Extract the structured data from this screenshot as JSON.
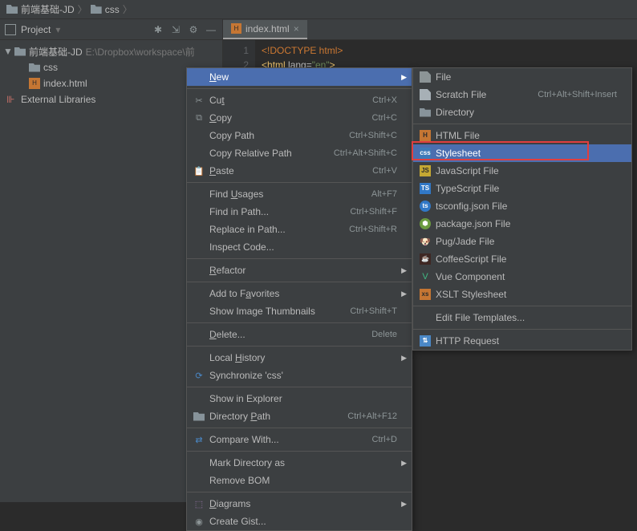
{
  "breadcrumb": {
    "root": "前端基础-JD",
    "sub": "css"
  },
  "toolwindow": {
    "title": "Project"
  },
  "tree": {
    "project_name": "前端基础-JD",
    "project_path": "E:\\Dropbox\\workspace\\前",
    "css_folder": "css",
    "index_file": "index.html",
    "ext_libs": "External Libraries"
  },
  "tab": {
    "name": "index.html"
  },
  "code": {
    "doctype": "<!DOCTYPE html>",
    "line2_open": "<",
    "line2_tag": "html",
    "line2_attr": " lang=",
    "line2_str": "\"en\"",
    "line2_close": ">"
  },
  "ctx": {
    "new": "New",
    "cut": "Cut",
    "cut_sc": "Ctrl+X",
    "copy": "Copy",
    "copy_sc": "Ctrl+C",
    "copy_path": "Copy Path",
    "copy_path_sc": "Ctrl+Shift+C",
    "copy_rel": "Copy Relative Path",
    "copy_rel_sc": "Ctrl+Alt+Shift+C",
    "paste": "Paste",
    "paste_sc": "Ctrl+V",
    "find_usages": "Find Usages",
    "find_usages_sc": "Alt+F7",
    "find_in_path": "Find in Path...",
    "find_in_path_sc": "Ctrl+Shift+F",
    "replace_in_path": "Replace in Path...",
    "replace_in_path_sc": "Ctrl+Shift+R",
    "inspect": "Inspect Code...",
    "refactor": "Refactor",
    "favorites": "Add to Favorites",
    "thumbnails": "Show Image Thumbnails",
    "thumbnails_sc": "Ctrl+Shift+T",
    "delete": "Delete...",
    "delete_sc": "Delete",
    "local_history": "Local History",
    "sync": "Synchronize 'css'",
    "explorer": "Show in Explorer",
    "dir_path": "Directory Path",
    "dir_path_sc": "Ctrl+Alt+F12",
    "compare": "Compare With...",
    "compare_sc": "Ctrl+D",
    "mark_dir": "Mark Directory as",
    "remove_bom": "Remove BOM",
    "diagrams": "Diagrams",
    "gist": "Create Gist..."
  },
  "sub": {
    "file": "File",
    "scratch": "Scratch File",
    "scratch_sc": "Ctrl+Alt+Shift+Insert",
    "directory": "Directory",
    "html_file": "HTML File",
    "stylesheet": "Stylesheet",
    "js_file": "JavaScript File",
    "ts_file": "TypeScript File",
    "tsconfig": "tsconfig.json File",
    "package_json": "package.json File",
    "pug": "Pug/Jade File",
    "coffee": "CoffeeScript File",
    "vue": "Vue Component",
    "xslt": "XSLT Stylesheet",
    "templates": "Edit File Templates...",
    "http": "HTTP Request"
  }
}
